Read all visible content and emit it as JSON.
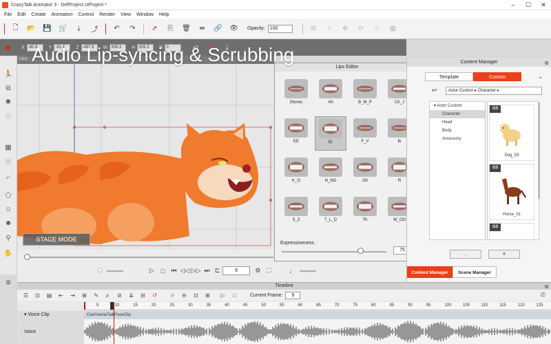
{
  "window": {
    "title": "CrazyTalk Animator 3  -  DefProject.ctProject *"
  },
  "menu": [
    "File",
    "Edit",
    "Create",
    "Animation",
    "Control",
    "Render",
    "View",
    "Window",
    "Help"
  ],
  "toolbar": {
    "opacity_label": "Opacity:",
    "opacity_value": "100"
  },
  "transform": {
    "fields": [
      {
        "label": "X",
        "value": "-80.9"
      },
      {
        "label": "Y",
        "value": "-81.4"
      },
      {
        "label": "Z",
        "value": "-497.9"
      },
      {
        "label": "W",
        "value": "309.3"
      },
      {
        "label": "H",
        "value": "309.3"
      },
      {
        "label": "R",
        "value": "0"
      }
    ]
  },
  "caption": "Audio Lip-syncing & Scrubbing",
  "stage": {
    "strip_label": "FPS :",
    "mode_label": "STAGE MODE"
  },
  "playback": {
    "frame": "9"
  },
  "lips_editor": {
    "title": "Lips Editor",
    "visemes": [
      "(None)",
      "Ah",
      "B_M_P",
      "Ch_J",
      "EE",
      "Er",
      "F_V",
      "th",
      "K_G",
      "N_NG",
      "Oh",
      "R",
      "S_Z",
      "T_L_D",
      "Th",
      "W_OO"
    ],
    "selected": "Er",
    "expressiveness_label": "Expressiveness :",
    "expressiveness_value": "75",
    "expressiveness_level": 0.75
  },
  "content_manager": {
    "title": "Content Manager",
    "tabs": [
      "Template",
      "Custom"
    ],
    "active_tab": "Custom",
    "path": [
      "Actor Custom",
      "Character"
    ],
    "tree": [
      {
        "label": "Actor Custom",
        "root": true
      },
      {
        "label": "Character",
        "selected": true
      },
      {
        "label": "Head"
      },
      {
        "label": "Body"
      },
      {
        "label": "Accessory"
      }
    ],
    "items": [
      {
        "badge": "G3",
        "label": "Dog_03"
      },
      {
        "badge": "G3",
        "label": "Horse_01"
      },
      {
        "badge": "G3",
        "label": ""
      }
    ],
    "add_button": "+",
    "down_button": "↓",
    "bottom_tabs": [
      "Content Manager",
      "Scene Manager"
    ],
    "active_bottom_tab": "Content Manager"
  },
  "timeline": {
    "title": "Timeline",
    "current_frame_label": "Current Frame:",
    "current_frame": "9",
    "ticks": [
      "5",
      "10",
      "15",
      "20",
      "25",
      "30",
      "35",
      "40",
      "45",
      "50",
      "55",
      "60",
      "65",
      "70",
      "75",
      "80",
      "85",
      "90",
      "95",
      "100",
      "105",
      "110",
      "115",
      "120",
      "125"
    ],
    "tracks": [
      {
        "name": "Voice Clip",
        "clip": "CtaVisemeTalkPoseClip"
      },
      {
        "name": "Voice"
      }
    ]
  },
  "colors": {
    "accent": "#e8401a",
    "cat_orange": "#f07a2e",
    "cat_light": "#f7c9a2",
    "timeline_cursor": "#c01010"
  }
}
